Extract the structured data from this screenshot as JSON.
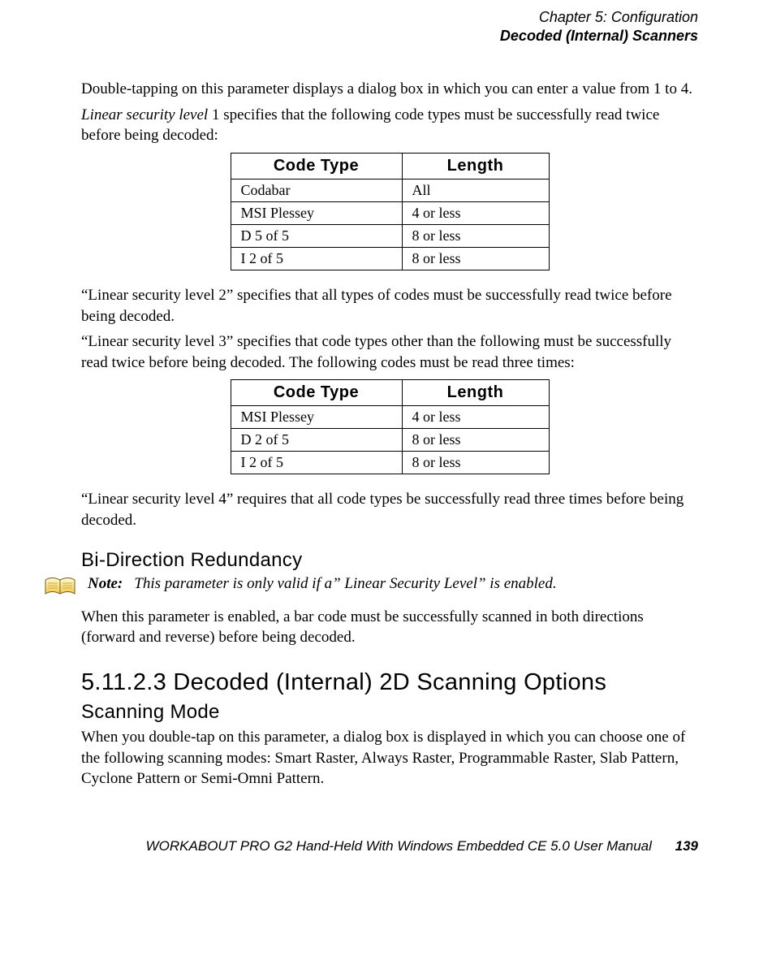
{
  "header": {
    "chapter_line": "Chapter 5: Configuration",
    "section_line": "Decoded (Internal) Scanners"
  },
  "paragraphs": {
    "p1": "Double-tapping on this parameter displays a dialog box in which you can enter a value from 1 to 4.",
    "p2_prefix_ital": "Linear security level",
    "p2_rest": " 1 specifies that the following code types must be successfully read twice before being decoded:",
    "p3": "“Linear security level 2” specifies that all types of codes must be successfully read twice before being decoded.",
    "p4": "“Linear security level 3” specifies that code types other than the following must be successfully read twice before being decoded. The following codes must be read three times:",
    "p5": "“Linear security level 4” requires that all code types be successfully read three times before being decoded.",
    "p6": "When this parameter is enabled, a bar code must be successfully scanned in both directions (forward and reverse) before being decoded.",
    "p7": "When you double-tap on this parameter, a dialog box is displayed in which you can choose one of the following scanning modes: Smart Raster, Always Raster, Programmable Raster, Slab Pattern, Cyclone Pattern or Semi-Omni Pattern."
  },
  "table_headers": {
    "col1": "Code Type",
    "col2": "Length"
  },
  "table1": [
    {
      "code": "Codabar",
      "len": "All"
    },
    {
      "code": "MSI Plessey",
      "len": "4 or less"
    },
    {
      "code": "D 5 of 5",
      "len": "8 or less"
    },
    {
      "code": "I 2 of 5",
      "len": "8 or less"
    }
  ],
  "table2": [
    {
      "code": "MSI Plessey",
      "len": "4 or less"
    },
    {
      "code": "D 2 of 5",
      "len": "8 or less"
    },
    {
      "code": "I 2 of 5",
      "len": "8 or less"
    }
  ],
  "headings": {
    "bidir": "Bi-Direction Redundancy",
    "sec_5_11_2_3": "5.11.2.3   Decoded (Internal) 2D Scanning Options",
    "scanning_mode": "Scanning Mode"
  },
  "note": {
    "label": "Note:",
    "text": "This parameter is only valid if a” Linear Security Level” is enabled."
  },
  "footer": {
    "text": "WORKABOUT PRO G2 Hand-Held With Windows Embedded CE 5.0 User Manual",
    "page": "139"
  }
}
